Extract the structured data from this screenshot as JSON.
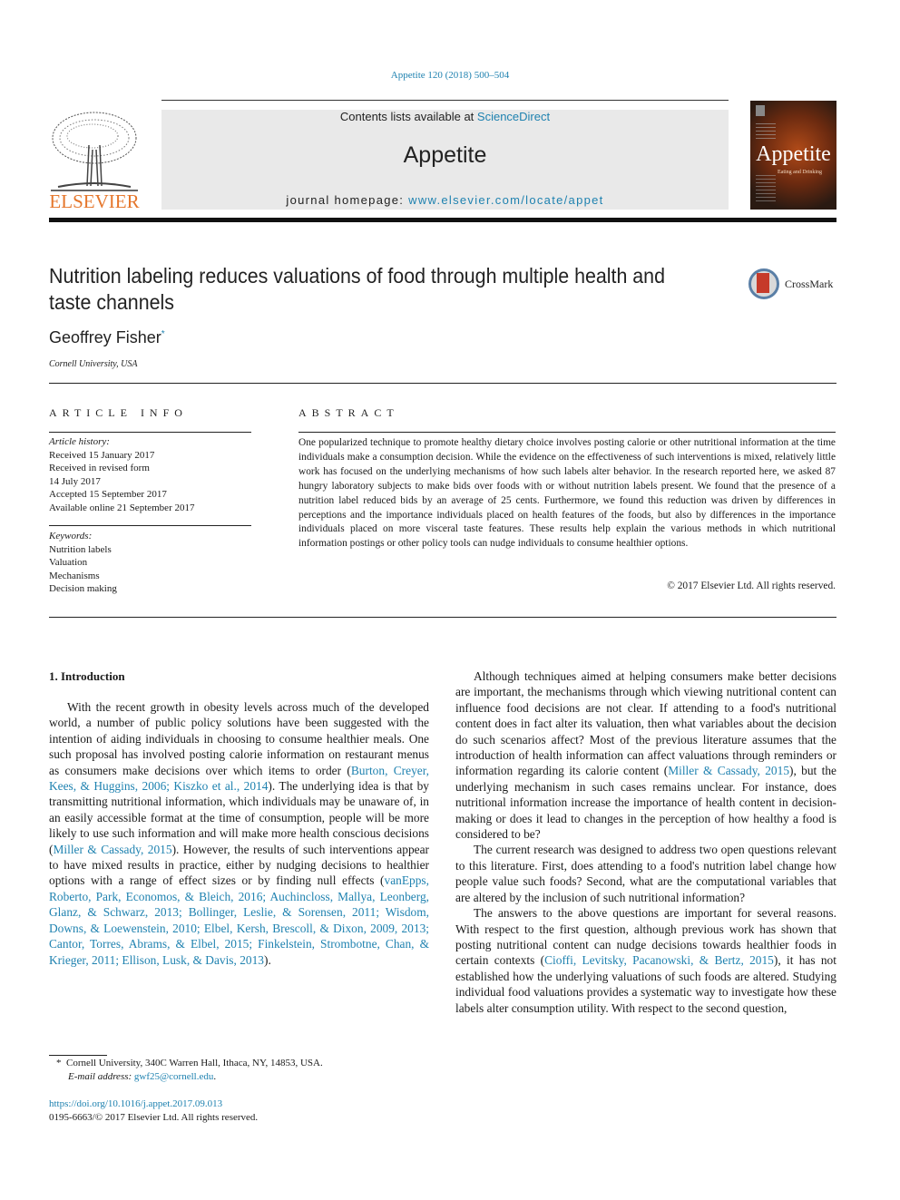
{
  "header": {
    "journal_ref": "Appetite 120 (2018) 500–504",
    "publisher_logo_text": "ELSEVIER",
    "contents_prefix": "Contents lists available at ",
    "contents_link": "ScienceDirect",
    "journal_name": "Appetite",
    "homepage_prefix": "journal homepage: ",
    "homepage_link": "www.elsevier.com/locate/appet",
    "cover_title": "Appetite",
    "cover_subtitle": "Eating and Drinking"
  },
  "article": {
    "title": "Nutrition labeling reduces valuations of food through multiple health and taste channels",
    "crossmark_label": "CrossMark",
    "author": "Geoffrey Fisher",
    "author_marker": "*",
    "affiliation": "Cornell University, USA"
  },
  "article_info": {
    "heading": "ARTICLE INFO",
    "history_label": "Article history:",
    "history": [
      "Received 15 January 2017",
      "Received in revised form",
      "14 July 2017",
      "Accepted 15 September 2017",
      "Available online 21 September 2017"
    ],
    "keywords_label": "Keywords:",
    "keywords": [
      "Nutrition labels",
      "Valuation",
      "Mechanisms",
      "Decision making"
    ]
  },
  "abstract": {
    "heading": "ABSTRACT",
    "text": "One popularized technique to promote healthy dietary choice involves posting calorie or other nutritional information at the time individuals make a consumption decision. While the evidence on the effectiveness of such interventions is mixed, relatively little work has focused on the underlying mechanisms of how such labels alter behavior. In the research reported here, we asked 87 hungry laboratory subjects to make bids over foods with or without nutrition labels present. We found that the presence of a nutrition label reduced bids by an average of 25 cents. Furthermore, we found this reduction was driven by differences in perceptions and the importance individuals placed on health features of the foods, but also by differences in the importance individuals placed on more visceral taste features. These results help explain the various methods in which nutritional information postings or other policy tools can nudge individuals to consume healthier options.",
    "copyright": "© 2017 Elsevier Ltd. All rights reserved."
  },
  "body": {
    "section_heading": "1.  Introduction",
    "left_p1": [
      {
        "t": "With the recent growth in obesity levels across much of the developed world, a number of public policy solutions have been suggested with the intention of aiding individuals in choosing to consume healthier meals. One such proposal has involved posting calorie information on restaurant menus as consumers make decisions over which items to order ("
      },
      {
        "c": "Burton, Creyer, Kees, & Huggins, 2006; Kiszko et al., 2014"
      },
      {
        "t": "). The underlying idea is that by transmitting nutritional information, which individuals may be unaware of, in an easily accessible format at the time of consumption, people will be more likely to use such information and will make more health conscious decisions ("
      },
      {
        "c": "Miller & Cassady, 2015"
      },
      {
        "t": "). However, the results of such interventions appear to have mixed results in practice, either by nudging decisions to healthier options with a range of effect sizes or by finding null effects ("
      },
      {
        "c": "vanEpps, Roberto, Park, Economos, & Bleich, 2016; Auchincloss, Mallya, Leonberg, Glanz, & Schwarz, 2013; Bollinger, Leslie, & Sorensen, 2011; Wisdom, Downs, & Loewenstein, 2010; Elbel, Kersh, Brescoll, & Dixon, 2009, 2013; Cantor, Torres, Abrams, & Elbel, 2015; Finkelstein, Strombotne, Chan, & Krieger, 2011; Ellison, Lusk, & Davis, 2013"
      },
      {
        "t": ")."
      }
    ],
    "right_p1": [
      {
        "t": "Although techniques aimed at helping consumers make better decisions are important, the mechanisms through which viewing nutritional content can influence food decisions are not clear. If attending to a food's nutritional content does in fact alter its valuation, then what variables about the decision do such scenarios affect? Most of the previous literature assumes that the introduction of health information can affect valuations through reminders or information regarding its calorie content ("
      },
      {
        "c": "Miller & Cassady, 2015"
      },
      {
        "t": "), but the underlying mechanism in such cases remains unclear. For instance, does nutritional information increase the importance of health content in decision-making or does it lead to changes in the perception of how healthy a food is considered to be?"
      }
    ],
    "right_p2": [
      {
        "t": "The current research was designed to address two open questions relevant to this literature. First, does attending to a food's nutrition label change how people value such foods? Second, what are the computational variables that are altered by the inclusion of such nutritional information?"
      }
    ],
    "right_p3": [
      {
        "t": "The answers to the above questions are important for several reasons. With respect to the first question, although previous work has shown that posting nutritional content can nudge decisions towards healthier foods in certain contexts ("
      },
      {
        "c": "Cioffi, Levitsky, Pacanowski, & Bertz, 2015"
      },
      {
        "t": "), it has not established how the underlying valuations of such foods are altered. Studying individual food valuations provides a systematic way to investigate how these labels alter consumption utility. With respect to the second question,"
      }
    ]
  },
  "footer": {
    "footnote_marker": "*",
    "footnote_address": "Cornell University, 340C Warren Hall, Ithaca, NY, 14853, USA.",
    "email_label": "E-mail address: ",
    "email": "gwf25@cornell.edu",
    "doi": "https://doi.org/10.1016/j.appet.2017.09.013",
    "issn_copyright": "0195-6663/© 2017 Elsevier Ltd. All rights reserved."
  }
}
